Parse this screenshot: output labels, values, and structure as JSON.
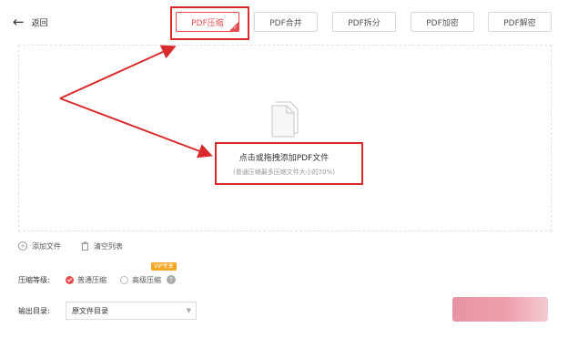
{
  "header": {
    "back_label": "返回",
    "tabs": [
      {
        "label": "PDF压缩",
        "active": true
      },
      {
        "label": "PDF合并",
        "active": false
      },
      {
        "label": "PDF拆分",
        "active": false
      },
      {
        "label": "PDF加密",
        "active": false
      },
      {
        "label": "PDF解密",
        "active": false
      }
    ]
  },
  "drop_zone": {
    "main_text": "点击或拖拽添加PDF文件",
    "sub_text": "(普通压缩最多压缩文件大小的70%)"
  },
  "file_actions": {
    "add_file": "添加文件",
    "clear_list": "清空列表"
  },
  "compress_level": {
    "label": "压缩等级:",
    "options": [
      {
        "label": "普通压缩",
        "selected": true
      },
      {
        "label": "高级压缩",
        "selected": false
      }
    ],
    "vip_badge": "VIP专享"
  },
  "output": {
    "label": "输出目录:",
    "selected": "原文件目录"
  },
  "colors": {
    "accent": "#e84b4b",
    "highlight": "#d92b2b",
    "vip": "#f5a623"
  },
  "icons": [
    "back-arrow-icon",
    "document-icon",
    "plus-circle-icon",
    "trash-icon",
    "radio-check-icon",
    "help-icon",
    "chevron-down-icon"
  ]
}
